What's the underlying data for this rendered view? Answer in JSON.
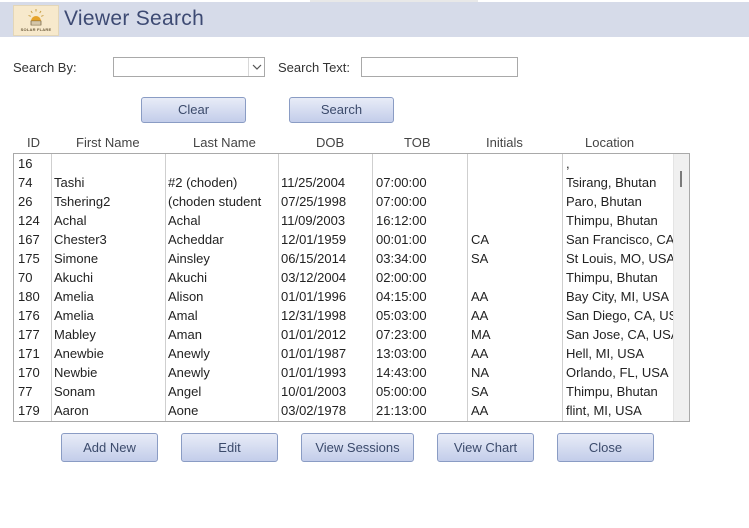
{
  "header": {
    "title": "Viewer Search",
    "logo_text": "SOLAR FLARE"
  },
  "search": {
    "by_label": "Search By:",
    "by_value": "",
    "text_label": "Search Text:",
    "text_value": ""
  },
  "buttons": {
    "clear": "Clear",
    "search": "Search"
  },
  "columns": [
    "ID",
    "First Name",
    "Last Name",
    "DOB",
    "TOB",
    "Initials",
    "Location"
  ],
  "rows": [
    [
      "16",
      "",
      "",
      "",
      "",
      "",
      ","
    ],
    [
      "74",
      "Tashi",
      "#2 (choden)",
      "11/25/2004",
      "07:00:00",
      "",
      "Tsirang, Bhutan"
    ],
    [
      "26",
      "Tshering2",
      "(choden student",
      "07/25/1998",
      "07:00:00",
      "",
      "Paro, Bhutan"
    ],
    [
      "124",
      "Achal",
      "Achal",
      "11/09/2003",
      "16:12:00",
      "",
      "Thimpu, Bhutan"
    ],
    [
      "167",
      "Chester3",
      "Acheddar",
      "12/01/1959",
      "00:01:00",
      "CA",
      "San Francisco, CA"
    ],
    [
      "175",
      "Simone",
      "Ainsley",
      "06/15/2014",
      "03:34:00",
      "SA",
      "St Louis, MO, USA"
    ],
    [
      "70",
      "Akuchi",
      "Akuchi",
      "03/12/2004",
      "02:00:00",
      "",
      "Thimpu, Bhutan"
    ],
    [
      "180",
      "Amelia",
      "Alison",
      "01/01/1996",
      "04:15:00",
      "AA",
      "Bay City, MI, USA"
    ],
    [
      "176",
      "Amelia",
      "Amal",
      "12/31/1998",
      "05:03:00",
      "AA",
      "San Diego, CA, US"
    ],
    [
      "177",
      "Mabley",
      "Aman",
      "01/01/2012",
      "07:23:00",
      "MA",
      "San Jose, CA, USA"
    ],
    [
      "171",
      "Anewbie",
      "Anewly",
      "01/01/1987",
      "13:03:00",
      "AA",
      "Hell, MI, USA"
    ],
    [
      "170",
      "Newbie",
      "Anewly",
      "01/01/1993",
      "14:43:00",
      "NA",
      "Orlando, FL, USA"
    ],
    [
      "77",
      "Sonam",
      "Angel",
      "10/01/2003",
      "05:00:00",
      "SA",
      "Thimpu, Bhutan"
    ],
    [
      "179",
      "Aaron",
      "Aone",
      "03/02/1978",
      "21:13:00",
      "AA",
      "flint, MI, USA"
    ]
  ],
  "actions": {
    "add_new": "Add New",
    "edit": "Edit",
    "view_sessions": "View Sessions",
    "view_chart": "View Chart",
    "close": "Close"
  },
  "colors": {
    "header_bg": "#d6dbe9",
    "title": "#3d4a73",
    "button_top": "#e8ecf7",
    "button_bottom": "#c3cdea"
  }
}
